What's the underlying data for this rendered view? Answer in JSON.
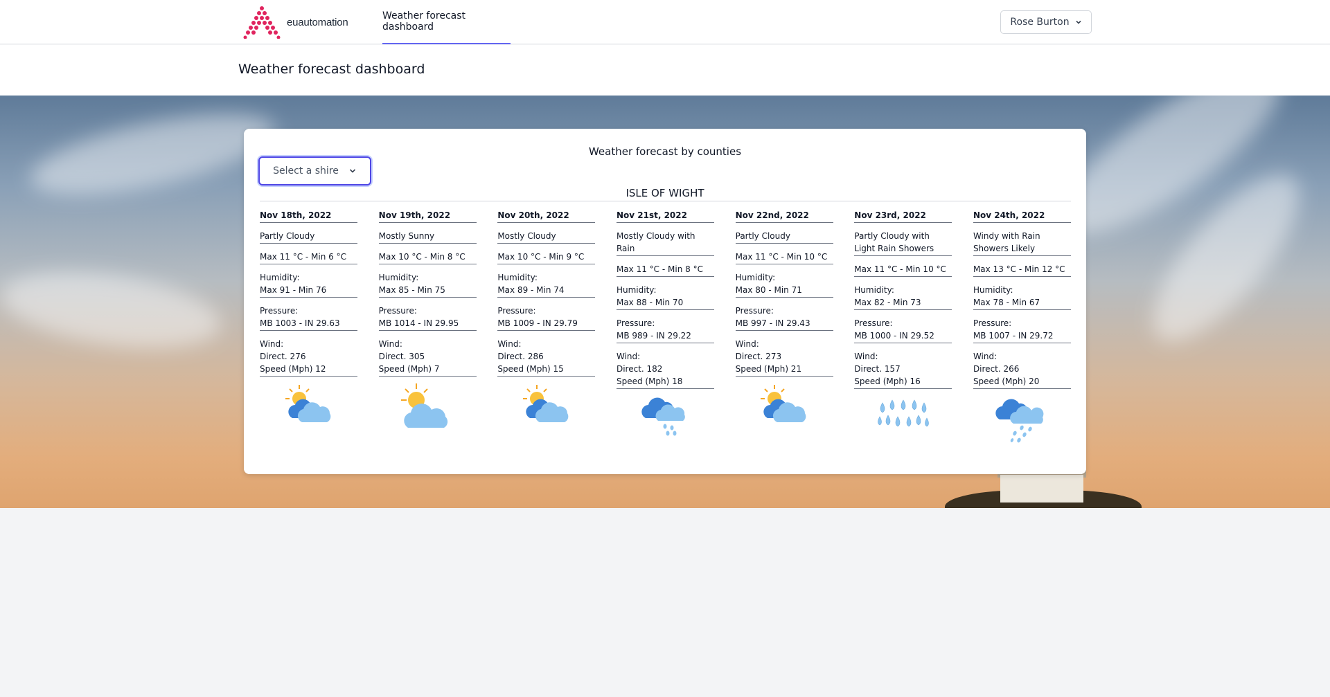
{
  "nav": {
    "logo_text": "euautomation",
    "tab_label": "Weather forecast dashboard",
    "user_name": "Rose Burton"
  },
  "header": {
    "title": "Weather forecast dashboard"
  },
  "card": {
    "title": "Weather forecast by counties",
    "select_label": "Select a shire",
    "location": "ISLE OF WIGHT"
  },
  "days": [
    {
      "date": "Nov 18th, 2022",
      "condition": "Partly Cloudy",
      "temp": "Max 11 °C - Min 6 °C",
      "humidity_label": "Humidity:",
      "humidity": "Max 91 - Min 76",
      "pressure_label": "Pressure:",
      "pressure": "MB 1003 - IN 29.63",
      "wind_label": "Wind:",
      "wind_dir": "Direct. 276",
      "wind_speed": "Speed (Mph) 12",
      "icon": "partly-cloudy-icon"
    },
    {
      "date": "Nov 19th, 2022",
      "condition": "Mostly Sunny",
      "temp": "Max 10 °C - Min 8 °C",
      "humidity_label": "Humidity:",
      "humidity": "Max 85 - Min 75",
      "pressure_label": "Pressure:",
      "pressure": "MB 1014 - IN 29.95",
      "wind_label": "Wind:",
      "wind_dir": "Direct. 305",
      "wind_speed": "Speed (Mph) 7",
      "icon": "mostly-sunny-icon"
    },
    {
      "date": "Nov 20th, 2022",
      "condition": "Mostly Cloudy",
      "temp": "Max 10 °C - Min 9 °C",
      "humidity_label": "Humidity:",
      "humidity": "Max 89 - Min 74",
      "pressure_label": "Pressure:",
      "pressure": "MB 1009 - IN 29.79",
      "wind_label": "Wind:",
      "wind_dir": "Direct. 286",
      "wind_speed": "Speed (Mph) 15",
      "icon": "partly-cloudy-icon"
    },
    {
      "date": "Nov 21st, 2022",
      "condition": "Mostly Cloudy with Rain",
      "temp": "Max 11 °C - Min 8 °C",
      "humidity_label": "Humidity:",
      "humidity": "Max 88 - Min 70",
      "pressure_label": "Pressure:",
      "pressure": "MB 989 - IN 29.22",
      "wind_label": "Wind:",
      "wind_dir": "Direct. 182",
      "wind_speed": "Speed (Mph) 18",
      "icon": "cloud-rain-icon"
    },
    {
      "date": "Nov 22nd, 2022",
      "condition": "Partly Cloudy",
      "temp": "Max 11 °C - Min 10 °C",
      "humidity_label": "Humidity:",
      "humidity": "Max 80 - Min 71",
      "pressure_label": "Pressure:",
      "pressure": "MB 997 - IN 29.43",
      "wind_label": "Wind:",
      "wind_dir": "Direct. 273",
      "wind_speed": "Speed (Mph) 21",
      "icon": "partly-cloudy-icon"
    },
    {
      "date": "Nov 23rd, 2022",
      "condition": "Partly Cloudy with Light Rain Showers",
      "temp": "Max 11 °C - Min 10 °C",
      "humidity_label": "Humidity:",
      "humidity": "Max 82 - Min 73",
      "pressure_label": "Pressure:",
      "pressure": "MB 1000 - IN 29.52",
      "wind_label": "Wind:",
      "wind_dir": "Direct. 157",
      "wind_speed": "Speed (Mph) 16",
      "icon": "raindrops-icon"
    },
    {
      "date": "Nov 24th, 2022",
      "condition": "Windy with Rain Showers Likely",
      "temp": "Max 13 °C - Min 12 °C",
      "humidity_label": "Humidity:",
      "humidity": "Max 78 - Min 67",
      "pressure_label": "Pressure:",
      "pressure": "MB 1007 - IN 29.72",
      "wind_label": "Wind:",
      "wind_dir": "Direct. 266",
      "wind_speed": "Speed (Mph) 20",
      "icon": "cloud-showers-icon"
    }
  ]
}
